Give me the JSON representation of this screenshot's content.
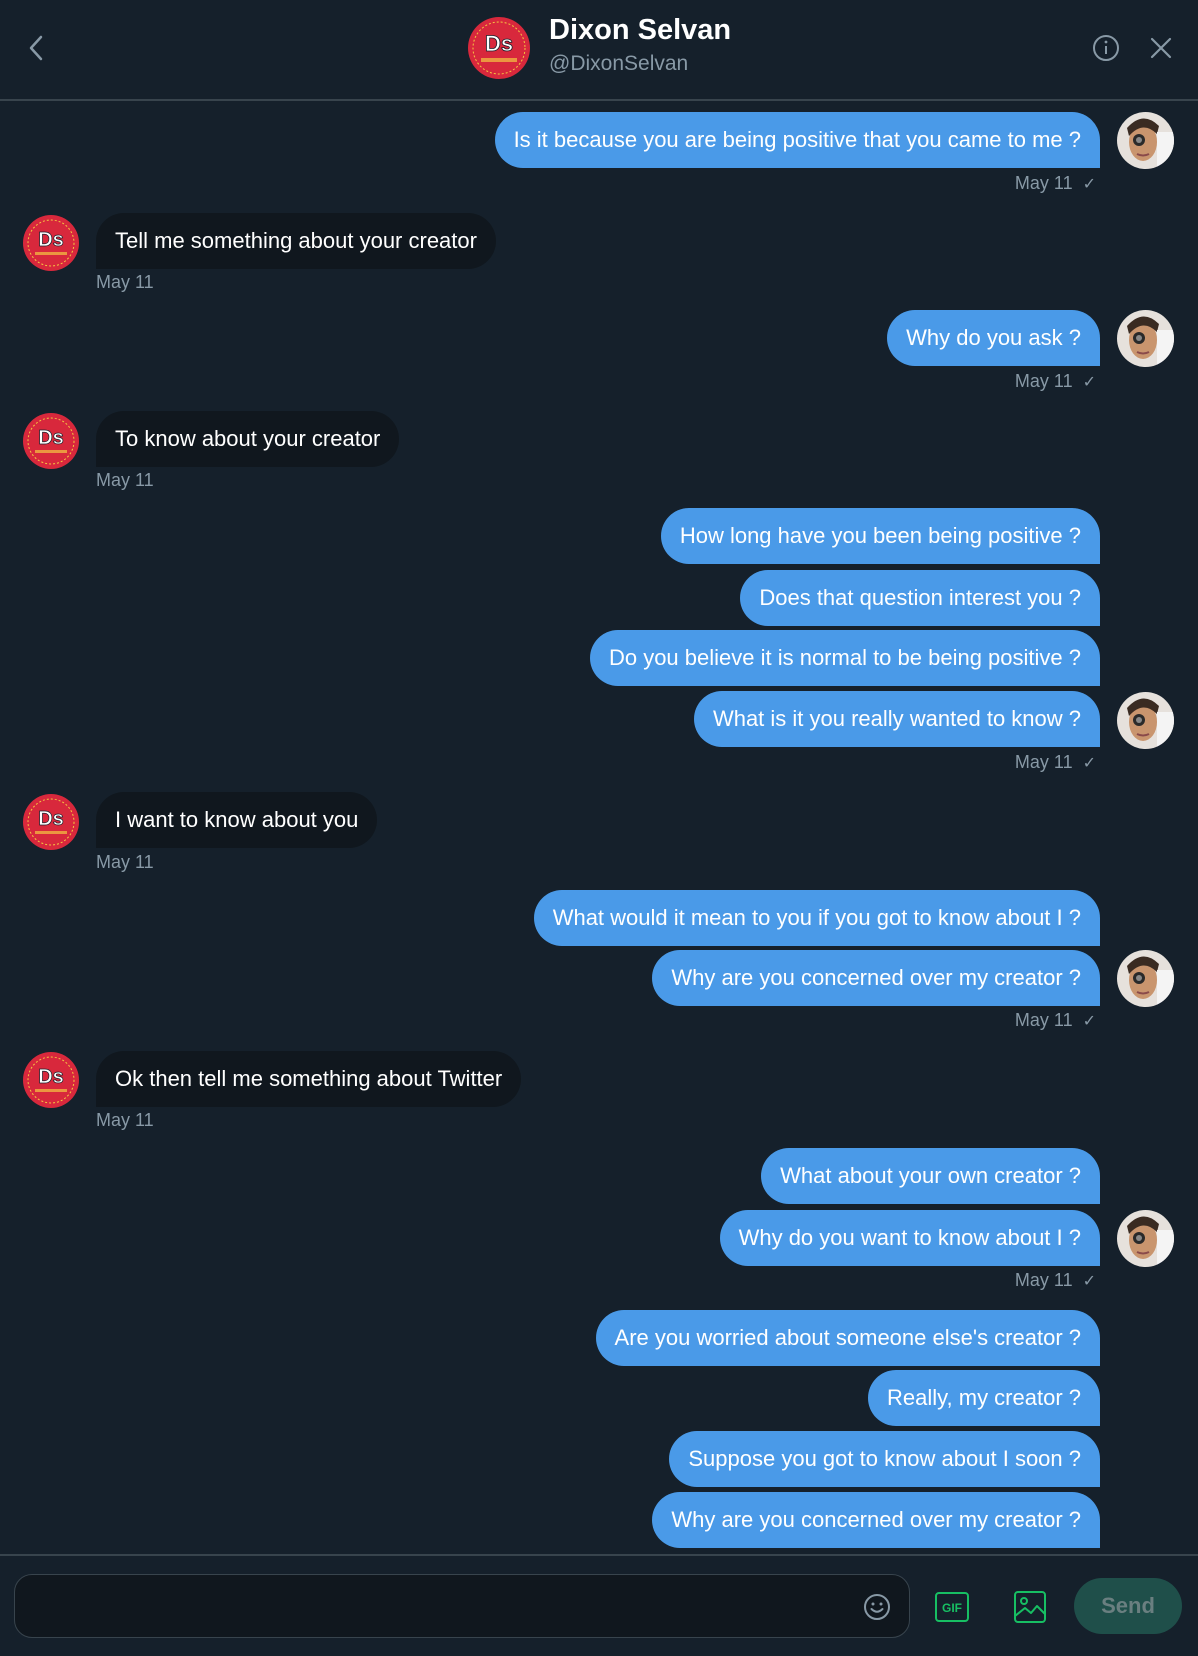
{
  "header": {
    "name": "Dixon Selvan",
    "handle": "@DixonSelvan",
    "avatar_initials": "Ds",
    "back_icon": "chevron-left-icon",
    "info_icon": "info-icon",
    "close_icon": "close-icon"
  },
  "messages": [
    {
      "dir": "out",
      "text": "Is it because you are being positive that you came to me ?"
    },
    {
      "dir": "out-ts",
      "time": "May 11",
      "check": "✓"
    },
    {
      "dir": "in",
      "text": "Tell me something about your creator"
    },
    {
      "dir": "in-ts",
      "time": "May 11"
    },
    {
      "dir": "out",
      "text": "Why do you ask ?"
    },
    {
      "dir": "out-ts",
      "time": "May 11",
      "check": "✓"
    },
    {
      "dir": "in",
      "text": "To know about your creator"
    },
    {
      "dir": "in-ts",
      "time": "May 11"
    },
    {
      "dir": "out",
      "text": "How long have you been being positive ?"
    },
    {
      "dir": "out",
      "text": "Does that question interest you ?"
    },
    {
      "dir": "out",
      "text": "Do you believe it is normal to be being positive ?"
    },
    {
      "dir": "out",
      "text": "What is it you really wanted to know ?"
    },
    {
      "dir": "out-ts",
      "time": "May 11",
      "check": "✓"
    },
    {
      "dir": "in",
      "text": "I want to know about you"
    },
    {
      "dir": "in-ts",
      "time": "May 11"
    },
    {
      "dir": "out",
      "text": "What would it mean to you if you got to know about I ?"
    },
    {
      "dir": "out",
      "text": "Why are you concerned over my creator ?"
    },
    {
      "dir": "out-ts",
      "time": "May 11",
      "check": "✓"
    },
    {
      "dir": "in",
      "text": "Ok then tell me something about Twitter"
    },
    {
      "dir": "in-ts",
      "time": "May 11"
    },
    {
      "dir": "out",
      "text": "What about your own creator ?"
    },
    {
      "dir": "out",
      "text": "Why do you want to know about I ?"
    },
    {
      "dir": "out-ts",
      "time": "May 11",
      "check": "✓"
    },
    {
      "dir": "out",
      "text": "Are you worried about someone else's creator ?"
    },
    {
      "dir": "out",
      "text": "Really, my creator ?"
    },
    {
      "dir": "out",
      "text": "Suppose you got to know about I soon ?"
    },
    {
      "dir": "out",
      "text": "Why are you concerned over my creator ?"
    }
  ],
  "composer": {
    "placeholder": "",
    "value": "",
    "emoji_icon": "emoji-icon",
    "gif_label": "GIF",
    "media_icon": "image-icon",
    "send_label": "Send"
  },
  "colors": {
    "background": "#15202b",
    "outgoing_bubble": "#4a9ae8",
    "incoming_bubble": "#10171e",
    "muted_text": "#8899a6",
    "brand_red": "#d8283c",
    "send_disabled": "#1f4f4a"
  }
}
